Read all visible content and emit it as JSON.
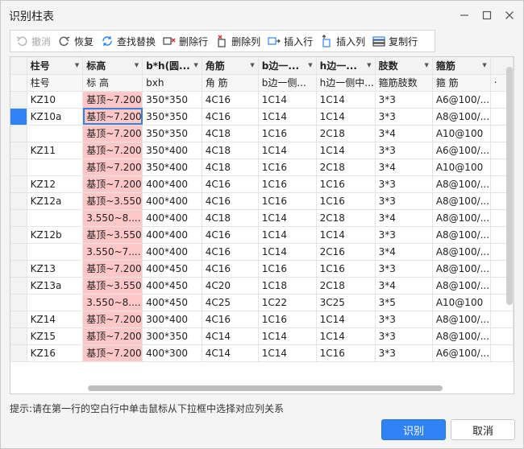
{
  "window": {
    "title": "识别柱表"
  },
  "toolbar": {
    "items": [
      {
        "label": "撤消",
        "icon": "undo-icon",
        "disabled": true
      },
      {
        "label": "恢复",
        "icon": "redo-icon",
        "disabled": false
      },
      {
        "label": "查找替换",
        "icon": "find-replace-icon",
        "disabled": false
      },
      {
        "label": "删除行",
        "icon": "delete-row-icon",
        "disabled": false
      },
      {
        "label": "删除列",
        "icon": "delete-column-icon",
        "disabled": false
      },
      {
        "label": "插入行",
        "icon": "insert-row-icon",
        "disabled": false
      },
      {
        "label": "插入列",
        "icon": "insert-column-icon",
        "disabled": false
      },
      {
        "label": "复制行",
        "icon": "copy-row-icon",
        "disabled": false
      }
    ]
  },
  "grid": {
    "mapping": [
      "柱号",
      "标高",
      "b*h(圆...",
      "角筋",
      "b边一...",
      "h边一...",
      "肢数",
      "箍筋"
    ],
    "headers": [
      "柱号",
      "标 高",
      "bxh",
      "角 筋",
      "b边一侧...",
      "h边一侧中...",
      "箍筋肢数",
      "箍 筋",
      "‧"
    ],
    "rows": [
      [
        "KZ10",
        "基顶~7.200",
        "350*350",
        "4C16",
        "1C14",
        "1C14",
        "3*3",
        "A6@100/..."
      ],
      [
        "KZ10a",
        "基顶~7.200",
        "350*350",
        "4C16",
        "1C14",
        "1C14",
        "3*3",
        "A8@100/..."
      ],
      [
        "",
        "基顶~7.200",
        "350*350",
        "4C18",
        "1C16",
        "2C18",
        "3*4",
        "A10@100"
      ],
      [
        "KZ11",
        "基顶~7.200",
        "350*400",
        "4C18",
        "1C14",
        "1C14",
        "3*3",
        "A6@100/..."
      ],
      [
        "",
        "基顶~7.200",
        "350*400",
        "4C18",
        "1C16",
        "2C18",
        "3*4",
        "A10@100"
      ],
      [
        "KZ12",
        "基顶~7.200",
        "400*400",
        "4C16",
        "1C16",
        "1C16",
        "3*3",
        "A8@100/..."
      ],
      [
        "KZ12a",
        "基顶~3.550",
        "400*400",
        "4C16",
        "1C16",
        "1C16",
        "3*3",
        "A8@100/..."
      ],
      [
        "",
        "3.550~8....",
        "400*400",
        "4C18",
        "1C14",
        "2C18",
        "3*4",
        "A8@100/..."
      ],
      [
        "KZ12b",
        "基顶~3.550",
        "400*400",
        "4C16",
        "1C14",
        "1C14",
        "3*3",
        "A8@100/..."
      ],
      [
        "",
        "3.550~7....",
        "400*400",
        "4C16",
        "1C14",
        "2C16",
        "3*4",
        "A8@100/..."
      ],
      [
        "KZ13",
        "基顶~7.200",
        "400*450",
        "4C16",
        "1C16",
        "1C16",
        "3*3",
        "A8@100/..."
      ],
      [
        "KZ13a",
        "基顶~3.550",
        "400*450",
        "4C20",
        "1C18",
        "2C18",
        "3*4",
        "A8@100/..."
      ],
      [
        "",
        "3.550~8....",
        "400*450",
        "4C25",
        "1C22",
        "3C25",
        "3*5",
        "A10@100"
      ],
      [
        "KZ14",
        "基顶~7.200",
        "300*400",
        "4C16",
        "1C16",
        "1C14",
        "3*3",
        "A8@100/..."
      ],
      [
        "KZ15",
        "基顶~7.200",
        "300*350",
        "4C14",
        "1C14",
        "1C14",
        "3*3",
        "A8@100/..."
      ],
      [
        "KZ16",
        "基顶~7.200",
        "400*300",
        "4C14",
        "1C14",
        "1C16",
        "3*3",
        "A6@100/..."
      ]
    ]
  },
  "footer": {
    "hint": "提示:请在第一行的空白行中单击鼠标从下拉框中选择对应列关系",
    "ok_label": "识别",
    "cancel_label": "取消"
  },
  "colors": {
    "accent": "#2f83f5",
    "highlight": "#ffc7c7"
  }
}
